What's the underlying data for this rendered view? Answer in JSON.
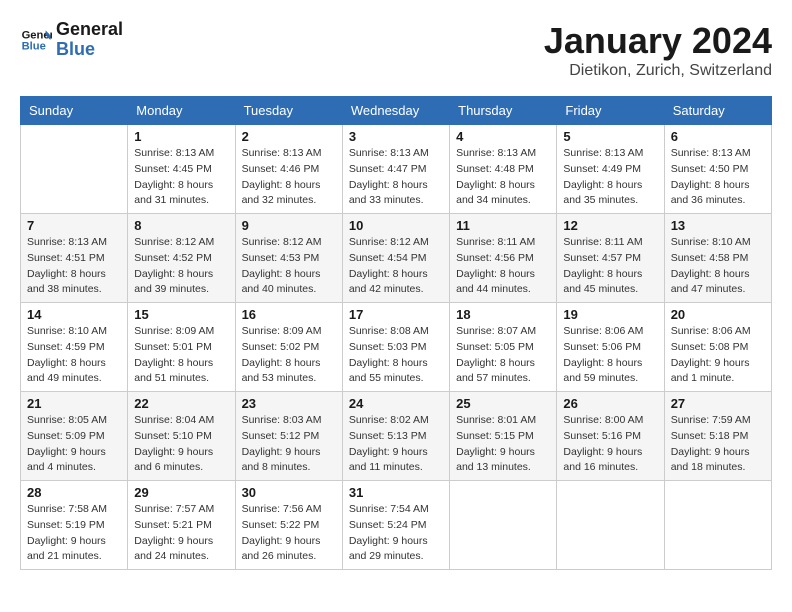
{
  "logo": {
    "text_general": "General",
    "text_blue": "Blue"
  },
  "header": {
    "month_year": "January 2024",
    "location": "Dietikon, Zurich, Switzerland"
  },
  "weekdays": [
    "Sunday",
    "Monday",
    "Tuesday",
    "Wednesday",
    "Thursday",
    "Friday",
    "Saturday"
  ],
  "weeks": [
    [
      {
        "day": "",
        "sunrise": "",
        "sunset": "",
        "daylight": ""
      },
      {
        "day": "1",
        "sunrise": "Sunrise: 8:13 AM",
        "sunset": "Sunset: 4:45 PM",
        "daylight": "Daylight: 8 hours and 31 minutes."
      },
      {
        "day": "2",
        "sunrise": "Sunrise: 8:13 AM",
        "sunset": "Sunset: 4:46 PM",
        "daylight": "Daylight: 8 hours and 32 minutes."
      },
      {
        "day": "3",
        "sunrise": "Sunrise: 8:13 AM",
        "sunset": "Sunset: 4:47 PM",
        "daylight": "Daylight: 8 hours and 33 minutes."
      },
      {
        "day": "4",
        "sunrise": "Sunrise: 8:13 AM",
        "sunset": "Sunset: 4:48 PM",
        "daylight": "Daylight: 8 hours and 34 minutes."
      },
      {
        "day": "5",
        "sunrise": "Sunrise: 8:13 AM",
        "sunset": "Sunset: 4:49 PM",
        "daylight": "Daylight: 8 hours and 35 minutes."
      },
      {
        "day": "6",
        "sunrise": "Sunrise: 8:13 AM",
        "sunset": "Sunset: 4:50 PM",
        "daylight": "Daylight: 8 hours and 36 minutes."
      }
    ],
    [
      {
        "day": "7",
        "sunrise": "Sunrise: 8:13 AM",
        "sunset": "Sunset: 4:51 PM",
        "daylight": "Daylight: 8 hours and 38 minutes."
      },
      {
        "day": "8",
        "sunrise": "Sunrise: 8:12 AM",
        "sunset": "Sunset: 4:52 PM",
        "daylight": "Daylight: 8 hours and 39 minutes."
      },
      {
        "day": "9",
        "sunrise": "Sunrise: 8:12 AM",
        "sunset": "Sunset: 4:53 PM",
        "daylight": "Daylight: 8 hours and 40 minutes."
      },
      {
        "day": "10",
        "sunrise": "Sunrise: 8:12 AM",
        "sunset": "Sunset: 4:54 PM",
        "daylight": "Daylight: 8 hours and 42 minutes."
      },
      {
        "day": "11",
        "sunrise": "Sunrise: 8:11 AM",
        "sunset": "Sunset: 4:56 PM",
        "daylight": "Daylight: 8 hours and 44 minutes."
      },
      {
        "day": "12",
        "sunrise": "Sunrise: 8:11 AM",
        "sunset": "Sunset: 4:57 PM",
        "daylight": "Daylight: 8 hours and 45 minutes."
      },
      {
        "day": "13",
        "sunrise": "Sunrise: 8:10 AM",
        "sunset": "Sunset: 4:58 PM",
        "daylight": "Daylight: 8 hours and 47 minutes."
      }
    ],
    [
      {
        "day": "14",
        "sunrise": "Sunrise: 8:10 AM",
        "sunset": "Sunset: 4:59 PM",
        "daylight": "Daylight: 8 hours and 49 minutes."
      },
      {
        "day": "15",
        "sunrise": "Sunrise: 8:09 AM",
        "sunset": "Sunset: 5:01 PM",
        "daylight": "Daylight: 8 hours and 51 minutes."
      },
      {
        "day": "16",
        "sunrise": "Sunrise: 8:09 AM",
        "sunset": "Sunset: 5:02 PM",
        "daylight": "Daylight: 8 hours and 53 minutes."
      },
      {
        "day": "17",
        "sunrise": "Sunrise: 8:08 AM",
        "sunset": "Sunset: 5:03 PM",
        "daylight": "Daylight: 8 hours and 55 minutes."
      },
      {
        "day": "18",
        "sunrise": "Sunrise: 8:07 AM",
        "sunset": "Sunset: 5:05 PM",
        "daylight": "Daylight: 8 hours and 57 minutes."
      },
      {
        "day": "19",
        "sunrise": "Sunrise: 8:06 AM",
        "sunset": "Sunset: 5:06 PM",
        "daylight": "Daylight: 8 hours and 59 minutes."
      },
      {
        "day": "20",
        "sunrise": "Sunrise: 8:06 AM",
        "sunset": "Sunset: 5:08 PM",
        "daylight": "Daylight: 9 hours and 1 minute."
      }
    ],
    [
      {
        "day": "21",
        "sunrise": "Sunrise: 8:05 AM",
        "sunset": "Sunset: 5:09 PM",
        "daylight": "Daylight: 9 hours and 4 minutes."
      },
      {
        "day": "22",
        "sunrise": "Sunrise: 8:04 AM",
        "sunset": "Sunset: 5:10 PM",
        "daylight": "Daylight: 9 hours and 6 minutes."
      },
      {
        "day": "23",
        "sunrise": "Sunrise: 8:03 AM",
        "sunset": "Sunset: 5:12 PM",
        "daylight": "Daylight: 9 hours and 8 minutes."
      },
      {
        "day": "24",
        "sunrise": "Sunrise: 8:02 AM",
        "sunset": "Sunset: 5:13 PM",
        "daylight": "Daylight: 9 hours and 11 minutes."
      },
      {
        "day": "25",
        "sunrise": "Sunrise: 8:01 AM",
        "sunset": "Sunset: 5:15 PM",
        "daylight": "Daylight: 9 hours and 13 minutes."
      },
      {
        "day": "26",
        "sunrise": "Sunrise: 8:00 AM",
        "sunset": "Sunset: 5:16 PM",
        "daylight": "Daylight: 9 hours and 16 minutes."
      },
      {
        "day": "27",
        "sunrise": "Sunrise: 7:59 AM",
        "sunset": "Sunset: 5:18 PM",
        "daylight": "Daylight: 9 hours and 18 minutes."
      }
    ],
    [
      {
        "day": "28",
        "sunrise": "Sunrise: 7:58 AM",
        "sunset": "Sunset: 5:19 PM",
        "daylight": "Daylight: 9 hours and 21 minutes."
      },
      {
        "day": "29",
        "sunrise": "Sunrise: 7:57 AM",
        "sunset": "Sunset: 5:21 PM",
        "daylight": "Daylight: 9 hours and 24 minutes."
      },
      {
        "day": "30",
        "sunrise": "Sunrise: 7:56 AM",
        "sunset": "Sunset: 5:22 PM",
        "daylight": "Daylight: 9 hours and 26 minutes."
      },
      {
        "day": "31",
        "sunrise": "Sunrise: 7:54 AM",
        "sunset": "Sunset: 5:24 PM",
        "daylight": "Daylight: 9 hours and 29 minutes."
      },
      {
        "day": "",
        "sunrise": "",
        "sunset": "",
        "daylight": ""
      },
      {
        "day": "",
        "sunrise": "",
        "sunset": "",
        "daylight": ""
      },
      {
        "day": "",
        "sunrise": "",
        "sunset": "",
        "daylight": ""
      }
    ]
  ]
}
